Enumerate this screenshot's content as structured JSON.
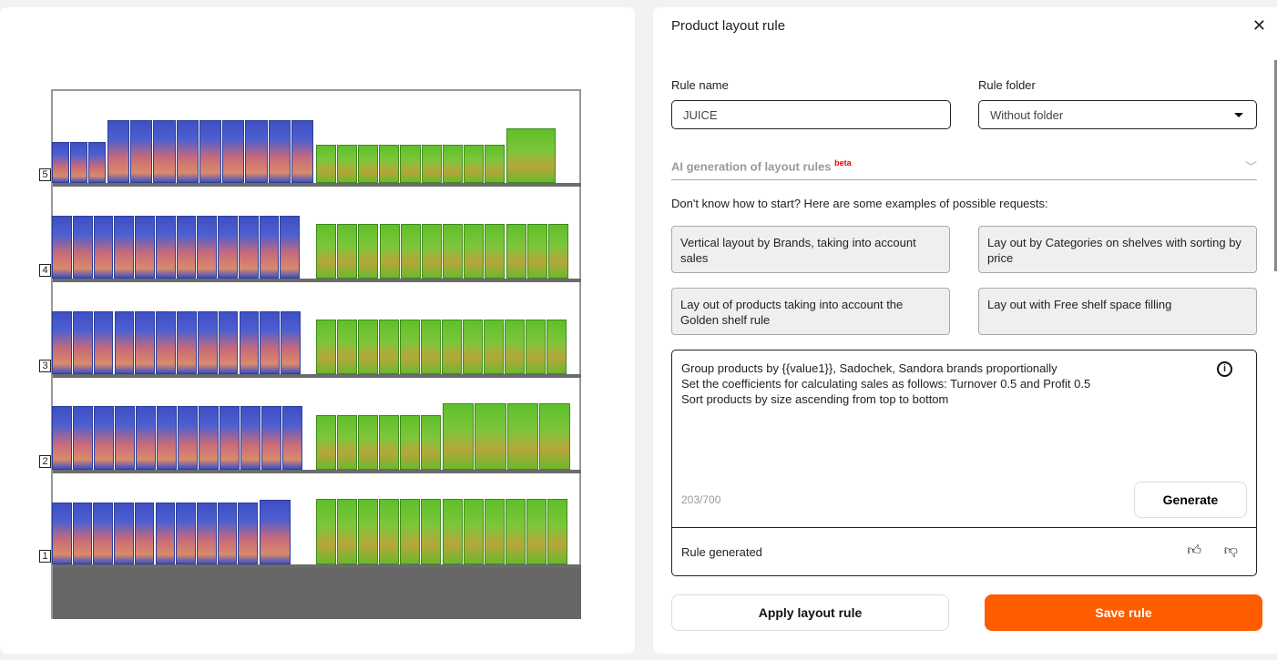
{
  "planogram": {
    "shelf_numbers": [
      "5",
      "4",
      "3",
      "2",
      "1"
    ]
  },
  "panel": {
    "title": "Product layout rule",
    "close_icon": "close-icon",
    "rule_name_label": "Rule name",
    "rule_name_value": "JUICE",
    "rule_folder_label": "Rule folder",
    "rule_folder_value": "Without folder",
    "ai_title": "AI generation of layout rules",
    "ai_badge": "beta",
    "hint": "Don't know how to start? Here are some examples of possible requests:",
    "examples": [
      "Vertical layout by Brands, taking into account sales",
      "Lay out by Categories on shelves with sorting by price",
      "Lay out of products taking into account the Golden shelf rule",
      "Lay out with Free shelf space filling"
    ],
    "prompt": "Group products by {{value1}}, Sadochek, Sandora brands proportionally\nSet the coefficients for calculating sales as follows: Turnover 0.5 and Profit 0.5\nSort products by size ascending from top to bottom",
    "char_count": "203/700",
    "generate_label": "Generate",
    "status": "Rule generated",
    "apply_label": "Apply layout rule",
    "save_label": "Save rule",
    "accent_color": "#ff5c00"
  }
}
